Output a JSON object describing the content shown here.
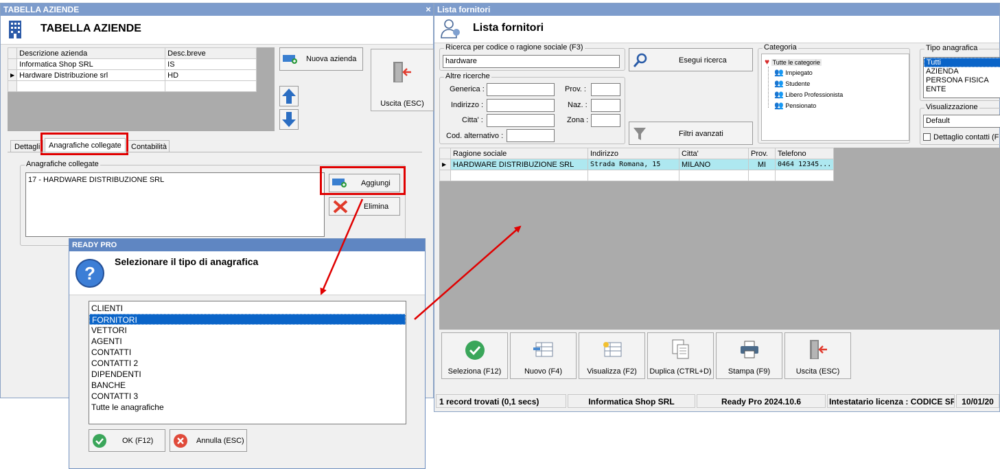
{
  "win_aziende": {
    "title": "TABELLA AZIENDE",
    "heading": "TABELLA AZIENDE",
    "table": {
      "columns": [
        "Descrizione azienda",
        "Desc.breve"
      ],
      "rows": [
        [
          "Informatica Shop SRL",
          "IS"
        ],
        [
          "Hardware Distribuzione srl",
          "HD"
        ]
      ]
    },
    "new_button": "Nuova azienda",
    "exit_button": "Uscita (ESC)",
    "tabs": [
      "Dettagli",
      "Anagrafiche collegate",
      "Contabilità"
    ],
    "group_title": "Anagrafiche collegate",
    "linked_items": [
      "17 - HARDWARE DISTRIBUZIONE SRL"
    ],
    "add_button": "Aggiungi",
    "delete_button": "Elimina"
  },
  "dialog": {
    "title": "READY PRO",
    "question": "Selezionare il tipo di anagrafica",
    "options": [
      "CLIENTI",
      "FORNITORI",
      "VETTORI",
      "AGENTI",
      "CONTATTI",
      "CONTATTI 2",
      "DIPENDENTI",
      "BANCHE",
      "CONTATTI 3",
      "Tutte le anagrafiche"
    ],
    "selected_index": 1,
    "ok_button": "OK (F12)",
    "cancel_button": "Annulla (ESC)"
  },
  "win_fornitori": {
    "title": "Lista fornitori",
    "heading": "Lista fornitori",
    "search_group": "Ricerca per codice o ragione sociale (F3)",
    "search_value": "hardware",
    "search_button": "Esegui ricerca",
    "other_group": "Altre ricerche",
    "fields": {
      "generica": "Generica :",
      "indirizzo": "Indirizzo :",
      "citta": "Citta' :",
      "cod_alt": "Cod. alternativo :",
      "prov": "Prov. :",
      "naz": "Naz. :",
      "zona": "Zona :"
    },
    "advanced_filters": "Filtri avanzati",
    "category_group": "Categoria",
    "categories": [
      "Tutte le categorie",
      "Impiegato",
      "Studente",
      "Libero Professionista",
      "Pensionato"
    ],
    "type_group": "Tipo anagrafica",
    "types": [
      "Tutti",
      "AZIENDA",
      "PERSONA FISICA",
      "ENTE"
    ],
    "view_group": "Visualizzazione",
    "view_value": "Default",
    "contact_detail": "Dettaglio contatti (F",
    "results": {
      "columns": [
        "Ragione sociale",
        "Indirizzo",
        "Citta'",
        "Prov.",
        "Telefono"
      ],
      "rows": [
        [
          "HARDWARE DISTRIBUZIONE SRL",
          "Strada Romana, 15",
          "MILANO",
          "MI",
          "0464 12345..."
        ]
      ]
    },
    "actions": [
      "Seleziona (F12)",
      "Nuovo (F4)",
      "Visualizza (F2)",
      "Duplica (CTRL+D)",
      "Stampa (F9)",
      "Uscita (ESC)"
    ],
    "status": {
      "records": "1 record trovati (0,1 secs)",
      "company": "Informatica Shop SRL",
      "version": "Ready Pro 2024.10.6",
      "license": "Intestatario licenza : CODICE SRL",
      "date": "10/01/20"
    }
  },
  "colors": {
    "highlight": "#e00000",
    "arrow": "#e00000",
    "selection": "#0a64c8",
    "row_selected": "#aee8f0"
  }
}
